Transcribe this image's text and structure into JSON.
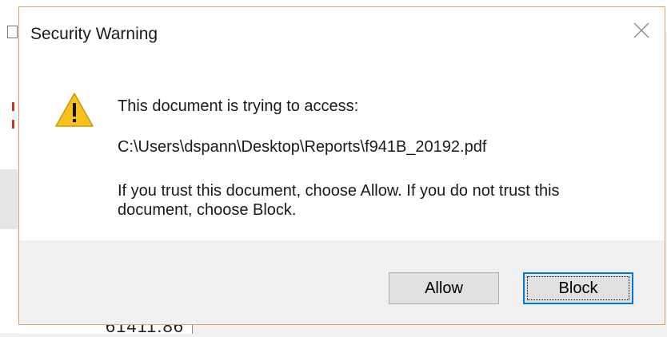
{
  "background": {
    "cell_value": "61411.86"
  },
  "dialog": {
    "title": "Security Warning",
    "close_icon": "close-icon",
    "warning_icon": "warning-icon",
    "access_text": "This document is trying to access:",
    "file_path": "C:\\Users\\dspann\\Desktop\\Reports\\f941B_20192.pdf",
    "trust_text": "If you trust this document, choose Allow. If you do not trust this document, choose Block.",
    "buttons": {
      "allow": "Allow",
      "block": "Block"
    }
  },
  "colors": {
    "dialog_border": "#e1a166",
    "warning_yellow": "#f7c21b",
    "focus_blue": "#0078d7"
  }
}
